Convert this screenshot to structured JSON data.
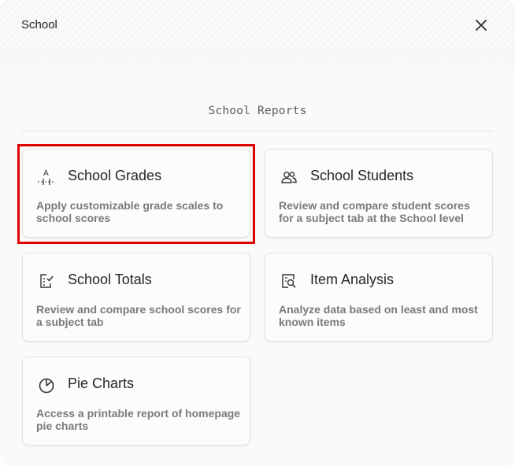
{
  "dialog": {
    "title": "School"
  },
  "section": {
    "title": "School Reports"
  },
  "cards": [
    {
      "title": "School Grades",
      "description": "Apply customizable grade scales to school scores",
      "icon": "grade-scale-icon"
    },
    {
      "title": "School Students",
      "description": "Review and compare student scores for a subject tab at the School level",
      "icon": "students-icon"
    },
    {
      "title": "School Totals",
      "description": "Review and compare school scores for a subject tab",
      "icon": "checklist-icon"
    },
    {
      "title": "Item Analysis",
      "description": "Analyze data based on least and most known items",
      "icon": "document-search-icon"
    },
    {
      "title": "Pie Charts",
      "description": "Access a printable report of homepage pie charts",
      "icon": "pie-chart-icon"
    }
  ],
  "colors": {
    "highlight": "#e00000",
    "card_border": "#e1e1e1",
    "description_text": "#7a7a7a"
  }
}
